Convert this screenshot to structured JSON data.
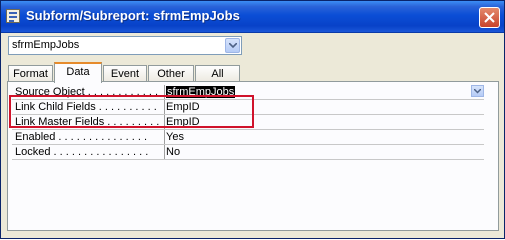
{
  "window": {
    "title": "Subform/Subreport: sfrmEmpJobs"
  },
  "object_selector": {
    "value": "sfrmEmpJobs"
  },
  "tabs": [
    {
      "label": "Format"
    },
    {
      "label": "Data"
    },
    {
      "label": "Event"
    },
    {
      "label": "Other"
    },
    {
      "label": "All"
    }
  ],
  "properties": [
    {
      "label": "Source Object . . . . . . . . . . . .",
      "value": "sfrmEmpJobs"
    },
    {
      "label": "Link Child Fields . . . . . . . . . .",
      "value": "EmpID"
    },
    {
      "label": "Link Master Fields . . . . . . . . .",
      "value": "EmpID"
    },
    {
      "label": "Enabled . . . . . . . . . . . . . . .",
      "value": "Yes"
    },
    {
      "label": "Locked . . . . . . . . . . . . . . . .",
      "value": "No"
    }
  ],
  "colors": {
    "highlight": "#d0132b",
    "titlebar": "#0b4ed6"
  }
}
